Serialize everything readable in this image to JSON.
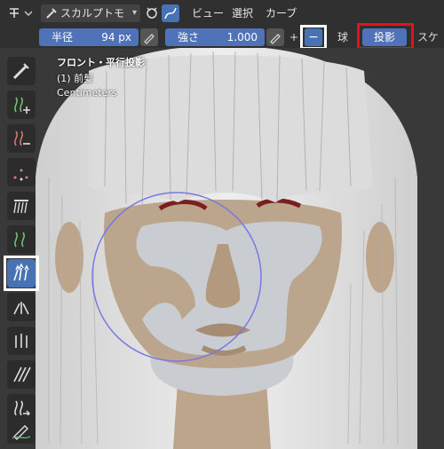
{
  "header": {
    "mode": "スカルプトモ",
    "menus": [
      "ビュー",
      "選択",
      "カーブ"
    ]
  },
  "toolsettings": {
    "radius_label": "半径",
    "radius_value": "94 px",
    "strength_label": "強さ",
    "strength_value": "1.000",
    "plus": "+",
    "minus": "−",
    "sphere": "球",
    "projection": "投影",
    "scale_cut": "スケー"
  },
  "viewport": {
    "view_name": "フロント・平行投影",
    "object_name": "(1) 前髪",
    "units": "Centimeters"
  },
  "tools": [
    "comb",
    "add",
    "delete",
    "density",
    "cut",
    "grow-shrink",
    "snake-hook",
    "pinch",
    "puff",
    "smooth",
    "slide",
    "draw"
  ],
  "colors": {
    "accent": "#4772b3",
    "highlight_red": "#e0141e",
    "skin": "#bba58c",
    "mask": "#c9ccd0",
    "hair": "#e8e8e8",
    "brush_circle": "#7a78e0"
  }
}
